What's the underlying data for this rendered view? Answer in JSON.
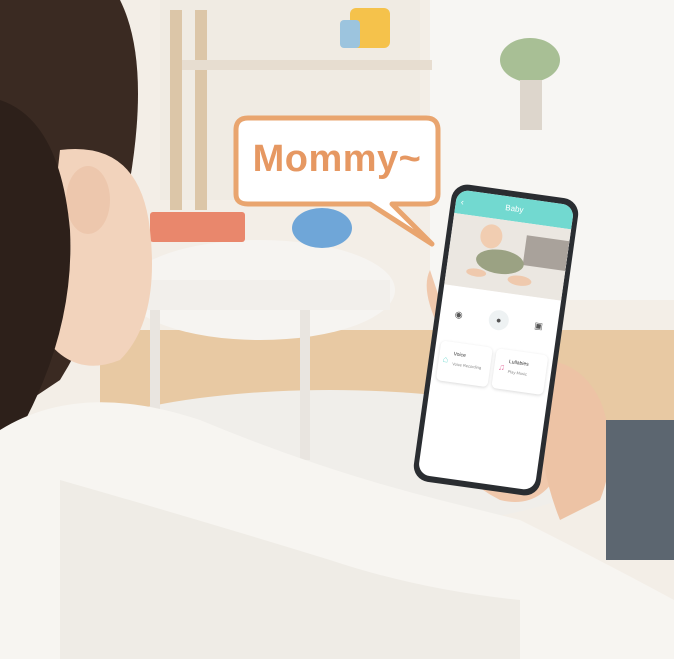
{
  "speech_bubble": {
    "text": "Mommy~"
  },
  "phone": {
    "header_title": "Baby",
    "cards": [
      {
        "title": "Voice",
        "subtitle": "Voice Recording"
      },
      {
        "title": "Lullabies",
        "subtitle": "Play Music"
      }
    ]
  },
  "colors": {
    "bubble_border": "#e9a56f",
    "bubble_text": "#e69862",
    "app_accent": "#72d9d0"
  }
}
